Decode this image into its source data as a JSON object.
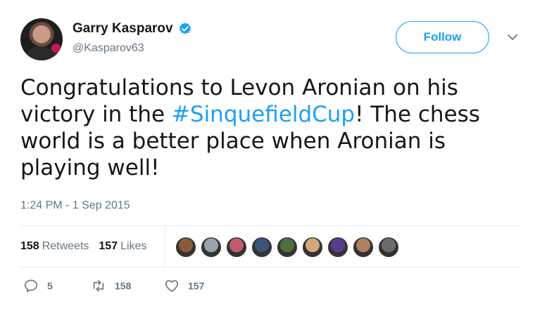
{
  "author": {
    "display_name": "Garry Kasparov",
    "handle": "@Kasparov63",
    "verified": true,
    "avatar_icon": "profile-photo"
  },
  "follow_button": {
    "label": "Follow"
  },
  "tweet": {
    "text_parts": [
      {
        "text": "Congratulations to Levon Aronian on his victory in the ",
        "hashtag": false
      },
      {
        "text": "#SinquefieldCup",
        "hashtag": true
      },
      {
        "text": "! The chess world is a better place when Aronian is playing well!",
        "hashtag": false
      }
    ],
    "timestamp": "1:24 PM - 1 Sep 2015"
  },
  "stats": {
    "retweets_count": "158",
    "retweets_label": "Retweets",
    "likes_count": "157",
    "likes_label": "Likes"
  },
  "likers": [
    {
      "color": "#8a5a3a"
    },
    {
      "color": "#9aa3ad"
    },
    {
      "color": "#c25b6e"
    },
    {
      "color": "#3b5478"
    },
    {
      "color": "#4f6e3d"
    },
    {
      "color": "#d4a77a"
    },
    {
      "color": "#5a3c8e"
    },
    {
      "color": "#b08060"
    },
    {
      "color": "#6b6b6b"
    }
  ],
  "actions": {
    "reply_count": "5",
    "retweet_count": "158",
    "like_count": "157"
  },
  "colors": {
    "accent": "#1da1f2",
    "secondary_text": "#657786",
    "primary_text": "#14171a",
    "divider": "#e6ecf0"
  }
}
